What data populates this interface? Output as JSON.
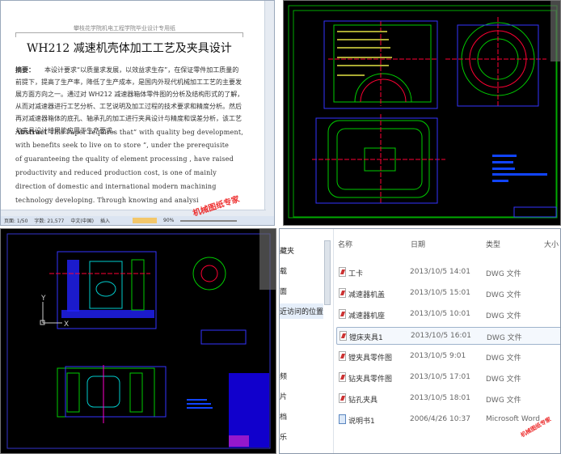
{
  "word": {
    "header": "攀枝花学院机电工程学院毕业设计专用纸",
    "title": "WH212 减速机壳体加工工艺及夹具设计",
    "abstract_cn_label": "摘要：",
    "abstract_cn_lines": [
      "本设计要求“以质量求发展，以效益求生存”，在保证零件加工质量的",
      "前提下，提高了生产率，降低了生产成本，是国内外现代机械加工工艺的主要发",
      "展方面方向之一。通过对 WH212 减速器箱体零件图的分析及结构形式的了解，",
      "从而对减速器进行工艺分析、工艺说明及加工过程的技术要求和精度分析。然后",
      "再对减速器箱体的底孔、轴承孔的加工进行夹具设计与精度和误差分析，该工艺",
      "与夹具设计结果能应用于生产要求。"
    ],
    "abstract_en_label": "Abstract",
    "abstract_en_lines": [
      "This Paper requires that” with quality beg development,",
      "with benefits seek to live on to store ”, under the prerequisite",
      "of guaranteeing the quality of element processing , have raised",
      "productivity and reduced production cost, is one of mainly",
      "direction  of  domestic  and  international  modern  machining",
      "technology  developing.  Through  knowing  and  analysi"
    ],
    "status": {
      "page": "页面: 1/50",
      "words": "字数: 21,577",
      "language": "中文(中国)",
      "mode": "插入",
      "zoom": "90%"
    },
    "watermark": "机械图纸专家"
  },
  "cad2": {
    "axis_y": "Y",
    "axis_x": "X"
  },
  "explorer": {
    "sidebar": [
      "藏夹",
      "载",
      "面",
      "近访问的位置",
      "频",
      "片",
      "档",
      "乐"
    ],
    "columns": {
      "name": "名称",
      "date": "日期",
      "type": "类型",
      "size": "大小"
    },
    "files": [
      {
        "name": "工卡",
        "date": "2013/10/5 14:01",
        "type": "DWG 文件",
        "icon": "dwg"
      },
      {
        "name": "减速器机盖",
        "date": "2013/10/5 15:01",
        "type": "DWG 文件",
        "icon": "dwg"
      },
      {
        "name": "减速器机座",
        "date": "2013/10/5 10:01",
        "type": "DWG 文件",
        "icon": "dwg"
      },
      {
        "name": "镗床夹具1",
        "date": "2013/10/5 16:01",
        "type": "DWG 文件",
        "icon": "dwg",
        "selected": true
      },
      {
        "name": "镗夹具零件图",
        "date": "2013/10/5 9:01",
        "type": "DWG 文件",
        "icon": "dwg"
      },
      {
        "name": "钻夹具零件图",
        "date": "2013/10/5 17:01",
        "type": "DWG 文件",
        "icon": "dwg"
      },
      {
        "name": "钻孔夹具",
        "date": "2013/10/5 18:01",
        "type": "DWG 文件",
        "icon": "dwg"
      },
      {
        "name": "说明书1",
        "date": "2006/4/26 10:37",
        "type": "Microsoft Word ...",
        "icon": "doc"
      }
    ],
    "watermark": "机械图纸专家"
  }
}
